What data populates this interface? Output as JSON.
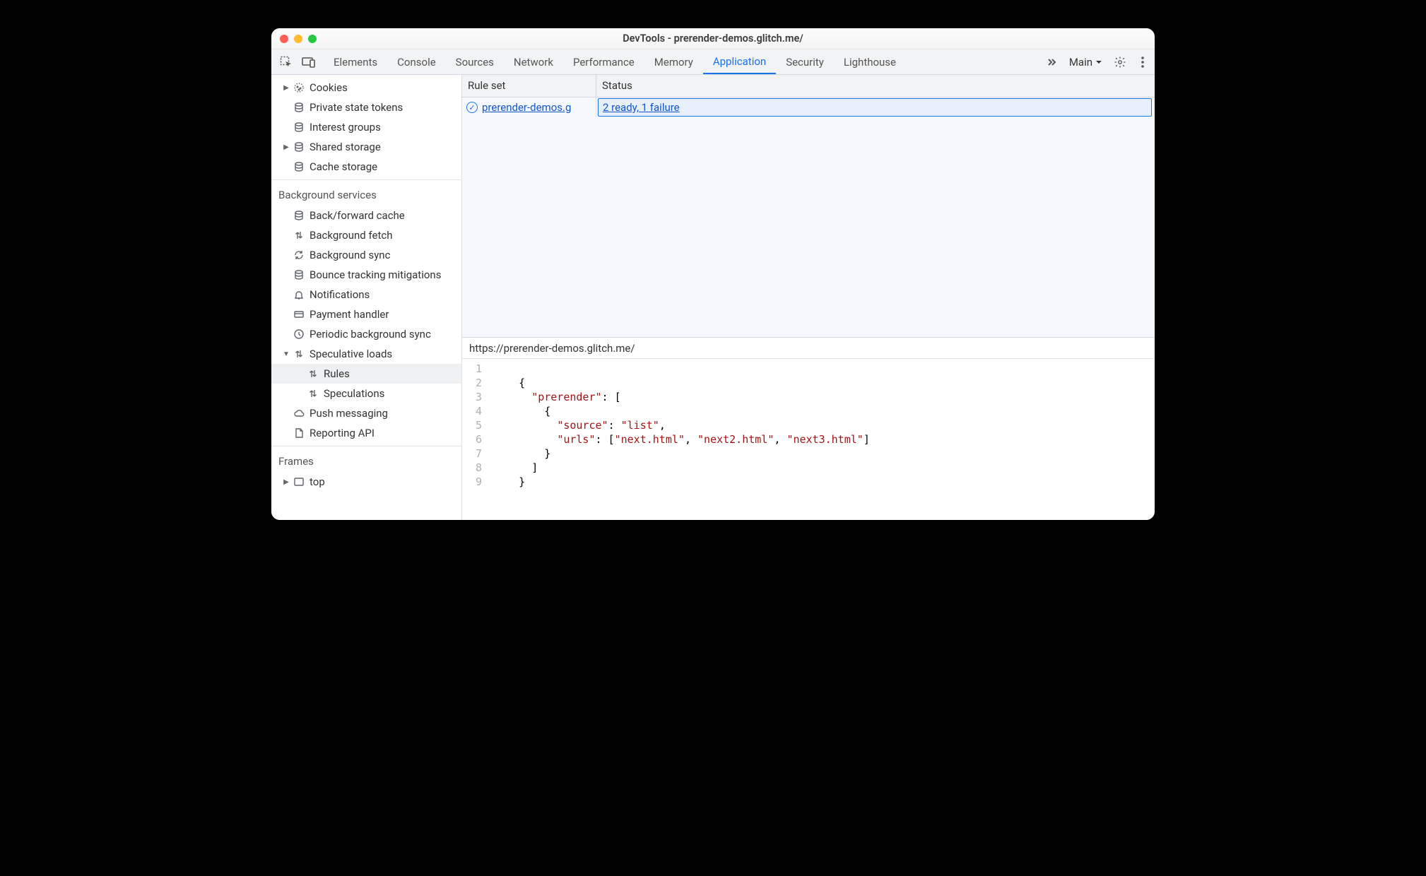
{
  "window_title": "DevTools - prerender-demos.glitch.me/",
  "toolbar": {
    "tabs": [
      "Elements",
      "Console",
      "Sources",
      "Network",
      "Performance",
      "Memory",
      "Application",
      "Security",
      "Lighthouse"
    ],
    "active_tab_index": 6,
    "target_label": "Main"
  },
  "sidebar": {
    "top_items": [
      {
        "label": "Cookies",
        "icon": "cookie",
        "arrow": "right"
      },
      {
        "label": "Private state tokens",
        "icon": "db",
        "arrow": "blank"
      },
      {
        "label": "Interest groups",
        "icon": "db",
        "arrow": "blank"
      },
      {
        "label": "Shared storage",
        "icon": "db",
        "arrow": "right"
      },
      {
        "label": "Cache storage",
        "icon": "db",
        "arrow": "blank"
      }
    ],
    "sections": [
      {
        "title": "Background services",
        "items": [
          {
            "label": "Back/forward cache",
            "icon": "db"
          },
          {
            "label": "Background fetch",
            "icon": "updown"
          },
          {
            "label": "Background sync",
            "icon": "sync"
          },
          {
            "label": "Bounce tracking mitigations",
            "icon": "db"
          },
          {
            "label": "Notifications",
            "icon": "bell"
          },
          {
            "label": "Payment handler",
            "icon": "card"
          },
          {
            "label": "Periodic background sync",
            "icon": "clock"
          },
          {
            "label": "Speculative loads",
            "icon": "updown",
            "arrow": "down",
            "children": [
              {
                "label": "Rules",
                "icon": "updown",
                "selected": true
              },
              {
                "label": "Speculations",
                "icon": "updown"
              }
            ]
          },
          {
            "label": "Push messaging",
            "icon": "cloud"
          },
          {
            "label": "Reporting API",
            "icon": "doc"
          }
        ]
      },
      {
        "title": "Frames",
        "items": [
          {
            "label": "top",
            "icon": "frame",
            "arrow": "right"
          }
        ]
      }
    ]
  },
  "table": {
    "col_ruleset": "Rule set",
    "col_status": "Status",
    "rows": [
      {
        "ruleset": "prerender-demos.g",
        "status": "2 ready, 1 failure",
        "selected": true
      }
    ]
  },
  "detail_url": "https://prerender-demos.glitch.me/",
  "code": {
    "line_numbers": [
      "1",
      "2",
      "3",
      "4",
      "5",
      "6",
      "7",
      "8",
      "9"
    ],
    "key_prerender": "\"prerender\"",
    "key_source": "\"source\"",
    "val_list": "\"list\"",
    "key_urls": "\"urls\"",
    "url1": "\"next.html\"",
    "url2": "\"next2.html\"",
    "url3": "\"next3.html\""
  }
}
